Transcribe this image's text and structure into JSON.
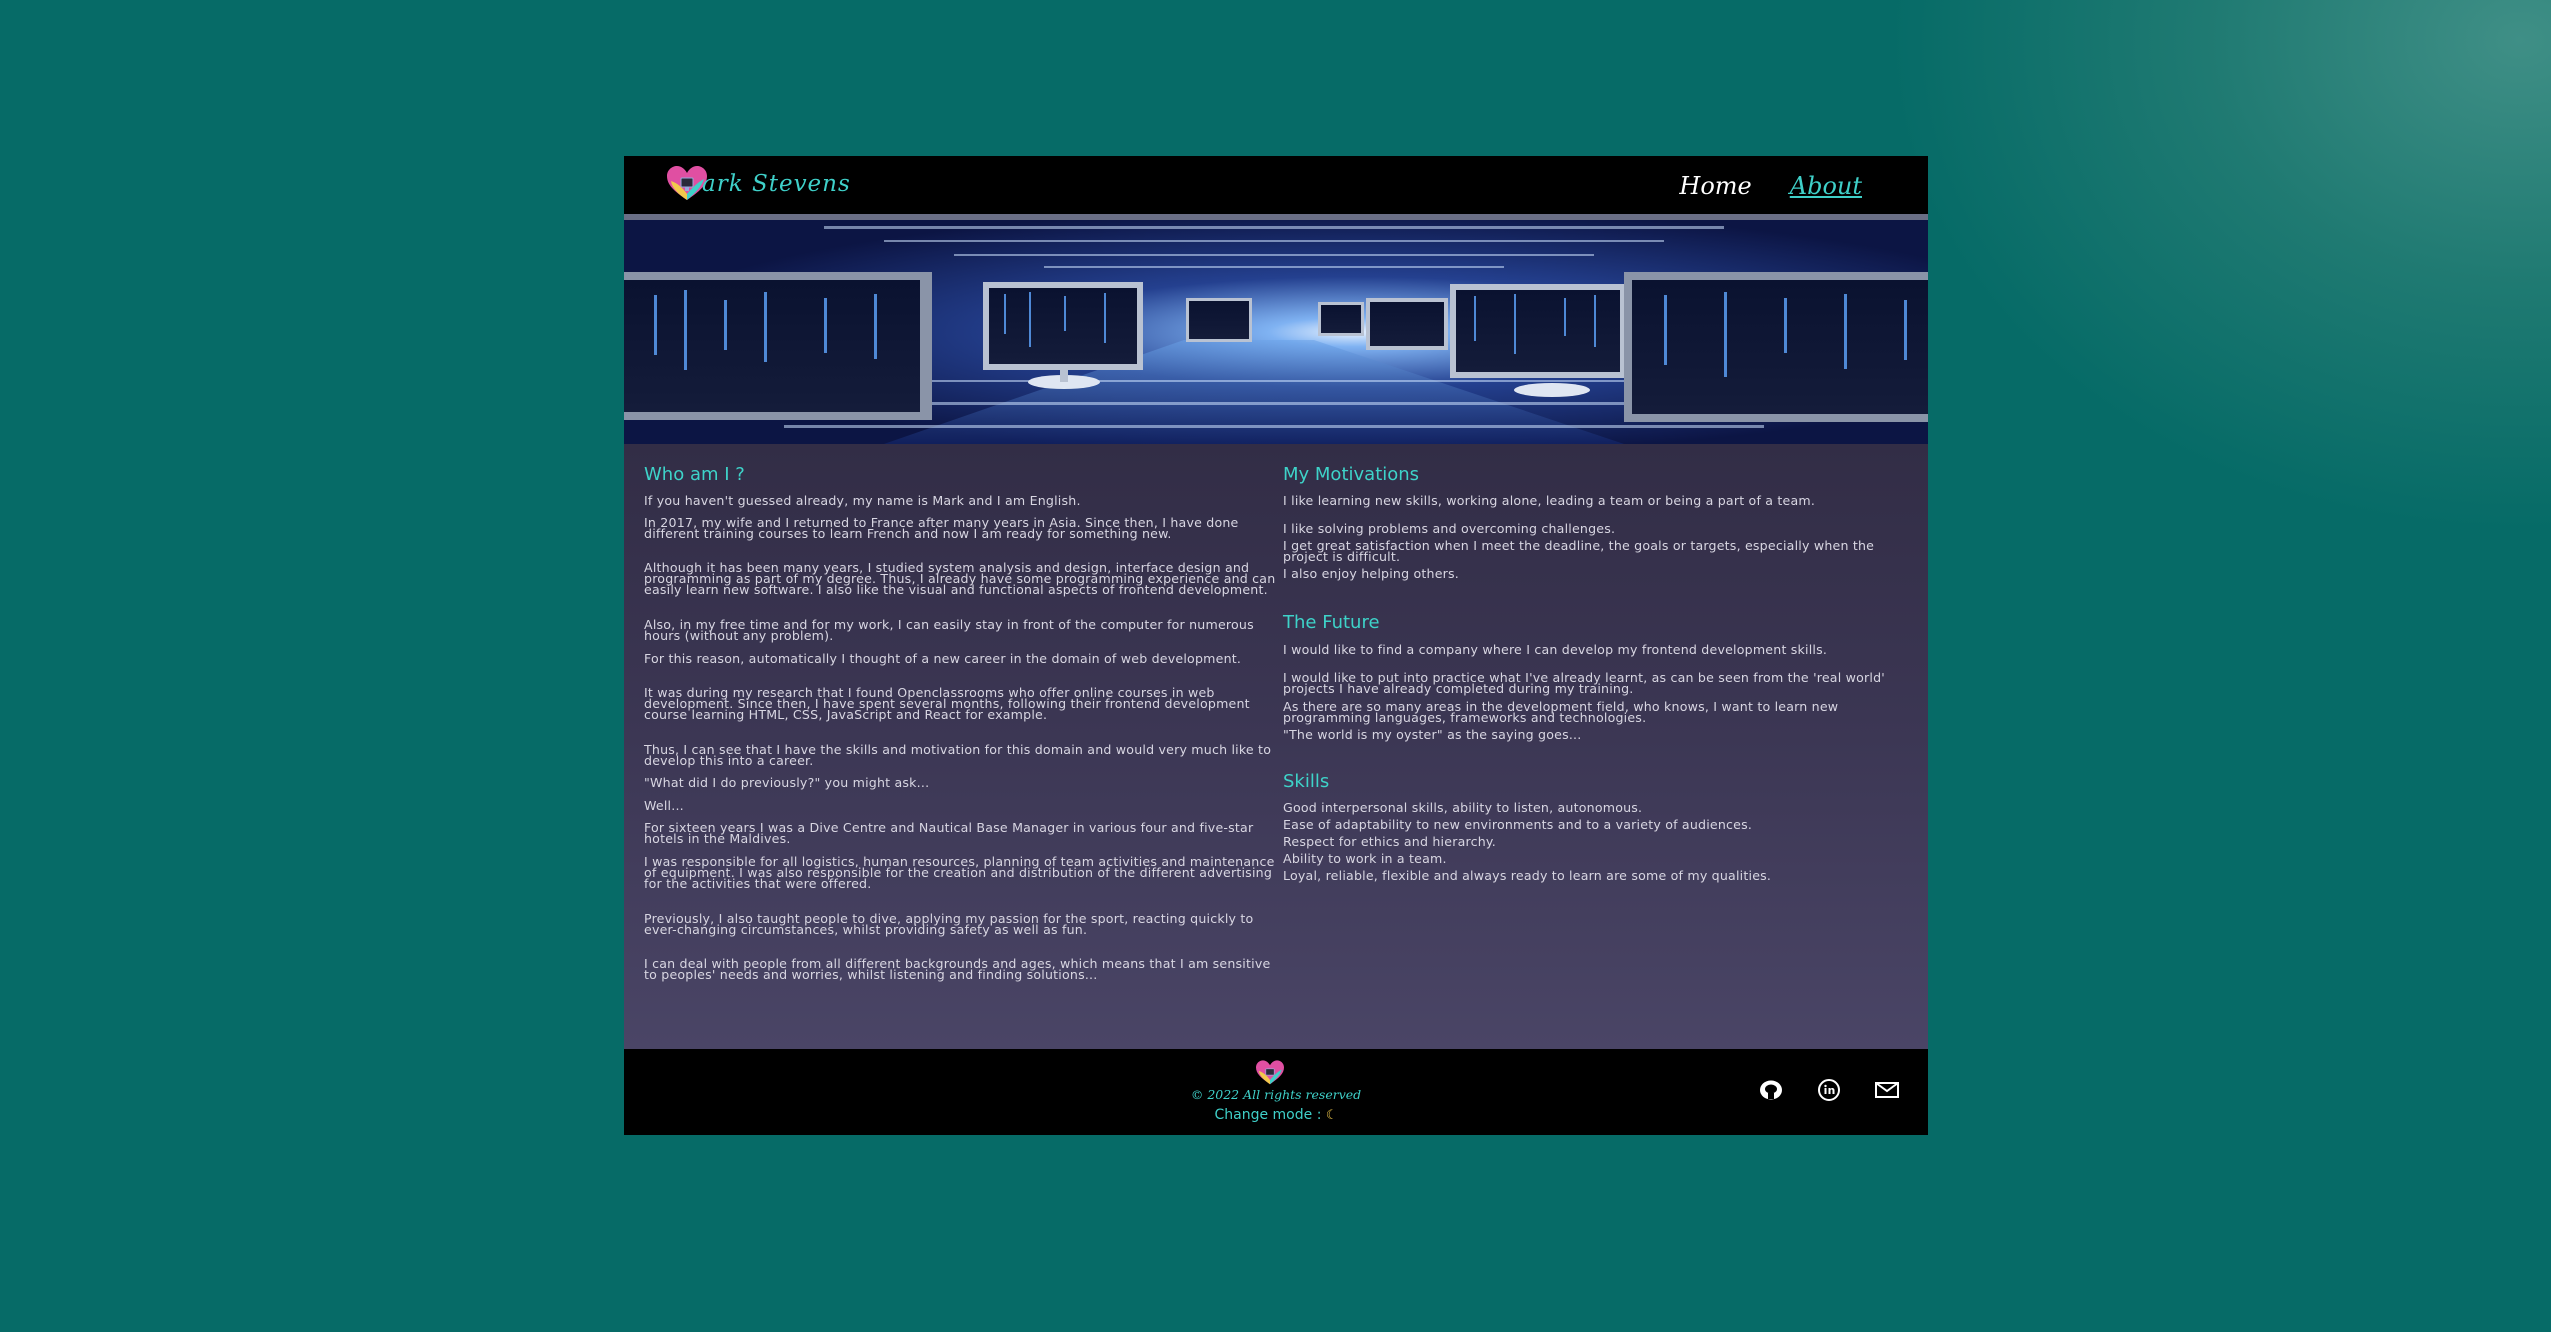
{
  "header": {
    "logo_text": "ark Stevens",
    "nav": [
      {
        "label": "Home",
        "active": false
      },
      {
        "label": "About",
        "active": true
      }
    ]
  },
  "colors": {
    "accent": "#3fd0c9",
    "header_bg": "#000000",
    "main_top": "#322d46",
    "main_bottom": "#4a4566",
    "page_bg": "#056866"
  },
  "sections": {
    "who": {
      "title": "Who am I ?",
      "paragraphs": [
        "If you haven't guessed already, my name is Mark and I am English.",
        "In 2017, my wife and I returned to France after many years in Asia. Since then, I have done different training courses to learn French and now I am ready for something new.",
        "Although it has been many years, I studied system analysis and design, interface design and programming as part of my degree. Thus, I already have some programming experience and can easily learn new software. I also like the visual and functional aspects of frontend development.",
        "Also, in my free time and for my work, I can easily stay in front of the computer for numerous hours (without any problem).",
        "For this reason, automatically I thought of a new career in the domain of web development.",
        "It was during my research that I found Openclassrooms who offer online courses in web development. Since then, I have spent several months, following their frontend development course learning HTML, CSS, JavaScript and React for example.",
        "Thus, I can see that I have the skills and motivation for this domain and would very much like to develop this into a career.",
        "\"What did I do previously?\" you might ask...",
        "Well...",
        "For sixteen years I was a Dive Centre and Nautical Base Manager in various four and five-star hotels in the Maldives.",
        "I was responsible for all logistics, human resources, planning of team activities and maintenance of equipment. I was also responsible for the creation and distribution of the different advertising for the activities that were offered.",
        "Previously, I also taught people to dive, applying my passion for the sport, reacting quickly to ever-changing circumstances, whilst providing safety as well as fun.",
        "I can deal with people from all different backgrounds and ages, which means that I am sensitive to peoples' needs and worries, whilst listening and finding solutions..."
      ]
    },
    "motivations": {
      "title": "My Motivations",
      "paragraphs": [
        "I like learning new skills, working alone, leading a team or being a part of a team.",
        "I like solving problems and overcoming challenges.",
        "I get great satisfaction when I meet the deadline, the goals or targets, especially when the project is difficult.",
        "I also enjoy helping others."
      ]
    },
    "future": {
      "title": "The Future",
      "paragraphs": [
        "I would like to find a company where I can develop my frontend development skills.",
        "I would like to put into practice what I've already learnt, as can be seen from the 'real world' projects I have already completed during my training.",
        "As there are so many areas in the development field, who knows, I want to learn new programming languages, frameworks and technologies.",
        "\"The world is my oyster\" as the saying goes..."
      ]
    },
    "skills": {
      "title": "Skills",
      "paragraphs": [
        "Good interpersonal skills, ability to listen, autonomous.",
        "Ease of adaptability to new environments and to a variety of audiences.",
        "Respect for ethics and hierarchy.",
        "Ability to work in a team.",
        "Loyal, reliable, flexible and always ready to learn are some of my qualities."
      ]
    }
  },
  "footer": {
    "copyright": "© 2022 All rights reserved",
    "mode_label": "Change mode :",
    "mode_icon": "moon-icon",
    "socials": [
      "github-icon",
      "linkedin-icon",
      "mail-icon"
    ]
  }
}
